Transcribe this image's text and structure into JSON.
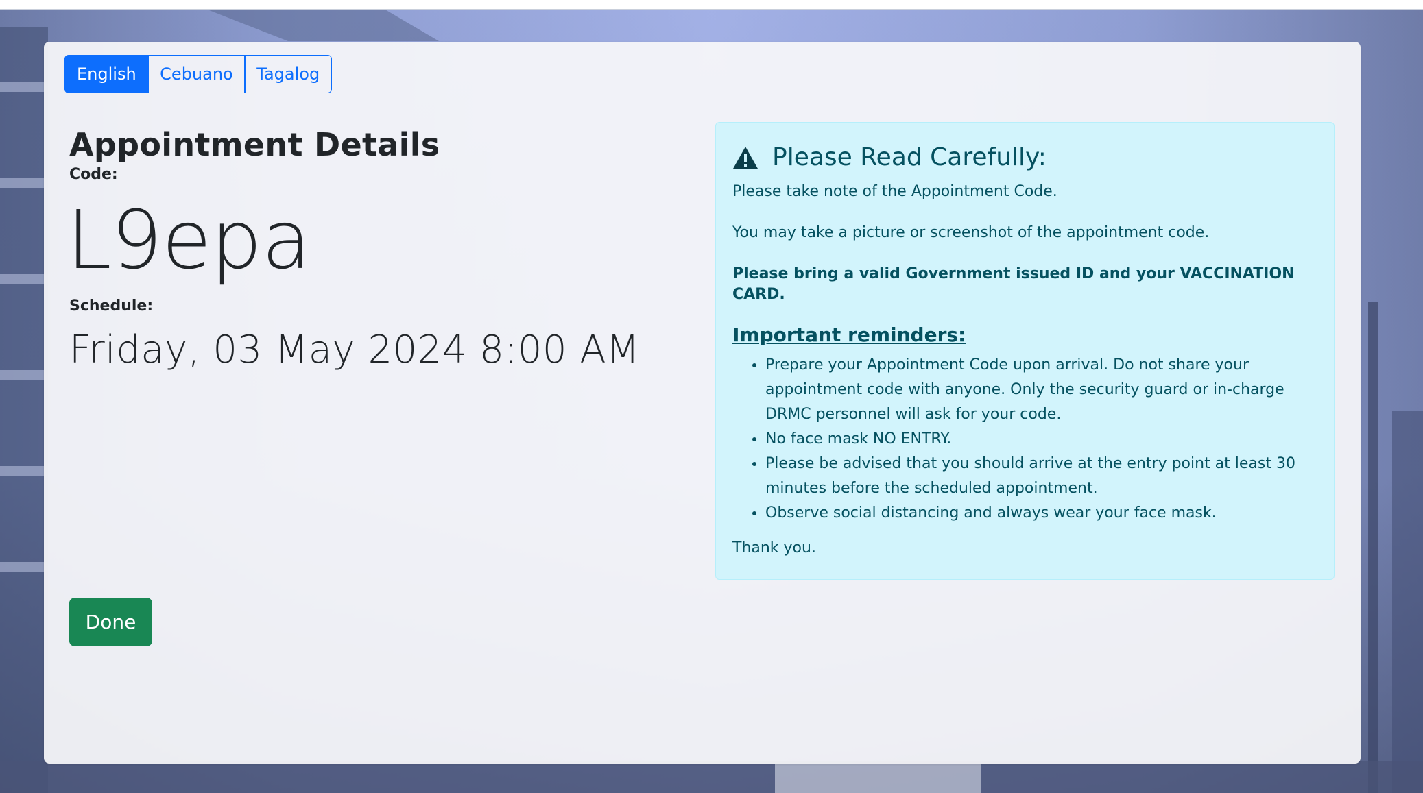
{
  "language_tabs": [
    {
      "label": "English",
      "active": true
    },
    {
      "label": "Cebuano",
      "active": false
    },
    {
      "label": "Tagalog",
      "active": false
    }
  ],
  "appointment": {
    "title": "Appointment Details",
    "code_label": "Code:",
    "code_value": "L9epa",
    "schedule_label": "Schedule:",
    "schedule_value": "Friday, 03 May 2024 8:00 AM"
  },
  "done_button": "Done",
  "notice": {
    "heading": "Please Read Carefully:",
    "icon": "warning-triangle-icon",
    "para1": "Please take note of the Appointment Code.",
    "para2": "You may take a picture or screenshot of the appointment code.",
    "para3_bold": "Please bring a valid Government issued ID and your VACCINATION CARD.",
    "reminders_title": "Important reminders:",
    "reminders": [
      "Prepare your Appointment Code upon arrival. Do not share your appointment code with anyone. Only the security guard or in-charge DRMC personnel will ask for your code.",
      "No face mask NO ENTRY.",
      "Please be advised that you should arrive at the entry point at least 30 minutes before the scheduled appointment.",
      "Observe social distancing and always wear your face mask."
    ],
    "closing": "Thank you."
  },
  "colors": {
    "primary": "#0d6efd",
    "success": "#198754",
    "info_bg": "#cff4fc",
    "info_text": "#055160"
  }
}
